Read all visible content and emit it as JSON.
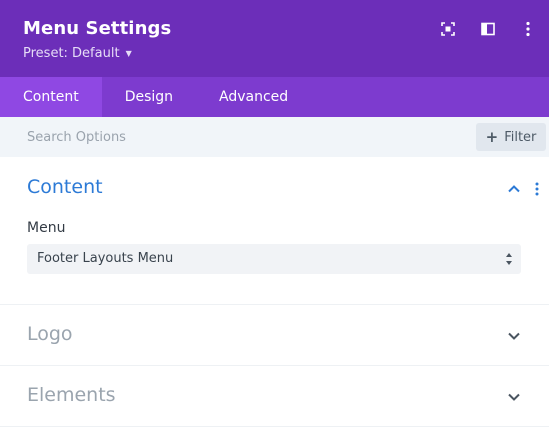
{
  "header": {
    "title": "Menu Settings",
    "preset_label": "Preset: Default",
    "icons": [
      "fullscreen-icon",
      "split-view-icon",
      "more-options-icon"
    ],
    "bg_color": "#6c2eb9"
  },
  "tabs": [
    {
      "label": "Content",
      "active": true
    },
    {
      "label": "Design",
      "active": false
    },
    {
      "label": "Advanced",
      "active": false
    }
  ],
  "search": {
    "placeholder": "Search Options",
    "filter_label": "Filter"
  },
  "sections": {
    "content": {
      "title": "Content",
      "expanded": true,
      "field_label": "Menu",
      "selected_value": "Footer Layouts Menu"
    },
    "logo": {
      "title": "Logo",
      "expanded": false
    },
    "elements": {
      "title": "Elements",
      "expanded": false
    }
  },
  "colors": {
    "accent": "#2c7ad6",
    "tab_bar": "#7d3bcf",
    "tab_active": "#8f48e3"
  }
}
